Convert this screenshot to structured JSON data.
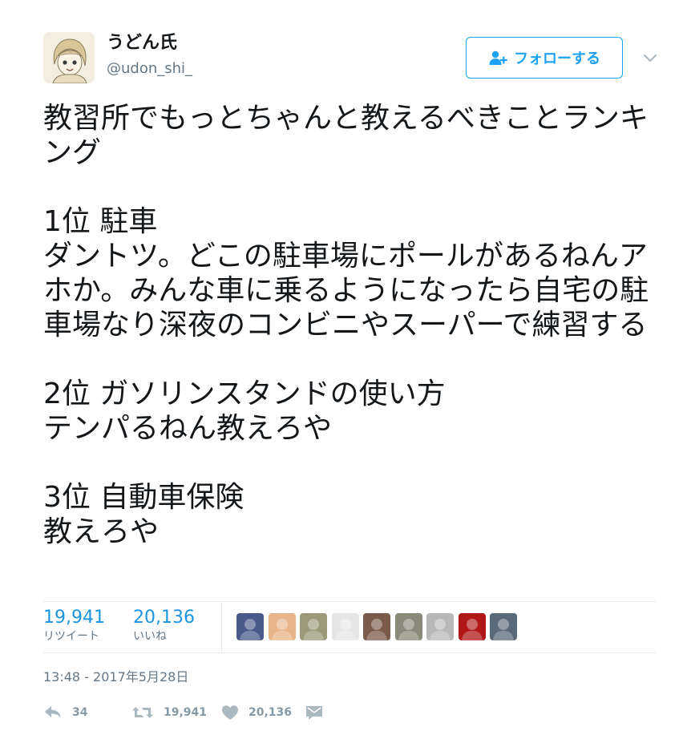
{
  "user": {
    "display_name": "うどん氏",
    "handle": "@udon_shi_",
    "avatar_icon": "anime-avatar"
  },
  "follow_button": {
    "label": "フォローする",
    "icon": "add-user-icon",
    "color": "#1da1f2"
  },
  "menu": {
    "icon": "chevron-down-icon"
  },
  "tweet": {
    "text": "教習所でもっとちゃんと教えるべきことランキング\n\n1位 駐車\nダントツ。どこの駐車場にポールがあるねんアホか。みんな車に乗るようになったら自宅の駐車場なり深夜のコンビニやスーパーで練習する\n\n2位 ガソリンスタンドの使い方\nテンパるねん教えろや\n\n3位 自動車保険\n教えろや"
  },
  "stats": {
    "retweets_value": "19,941",
    "retweets_label": "リツイート",
    "likes_value": "20,136",
    "likes_label": "いいね",
    "accent_color": "#1b95e0"
  },
  "likers": [
    {
      "name": "liker-avatar-1",
      "color": "#4a5a8a"
    },
    {
      "name": "liker-avatar-2",
      "color": "#e8b48a"
    },
    {
      "name": "liker-avatar-3",
      "color": "#9a9a7a"
    },
    {
      "name": "liker-avatar-4",
      "color": "#e6e6e6"
    },
    {
      "name": "liker-avatar-5",
      "color": "#7a5a4a"
    },
    {
      "name": "liker-avatar-6",
      "color": "#8a8a7a"
    },
    {
      "name": "liker-avatar-7",
      "color": "#b8b8b8"
    },
    {
      "name": "liker-avatar-8",
      "color": "#b01818"
    },
    {
      "name": "liker-avatar-9",
      "color": "#5a6a7a"
    }
  ],
  "timestamp": "13:48 - 2017年5月28日",
  "actions": {
    "reply_count": "34",
    "retweet_count": "19,941",
    "like_count": "20,136"
  }
}
